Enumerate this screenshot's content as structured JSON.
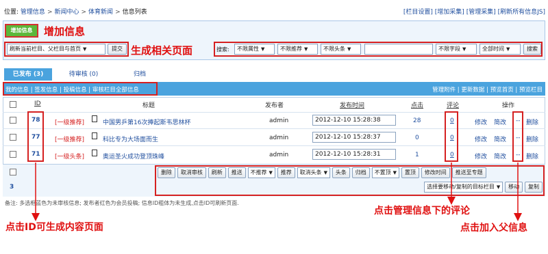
{
  "breadcrumb": {
    "prefix": "位置:",
    "items": [
      "管理信息",
      "新闻中心",
      "体育新闻",
      "信息列表"
    ],
    "sep": ">"
  },
  "top_links": [
    "[栏目设置]",
    "[增加采集]",
    "[管理采集]",
    "[刷新所有信息JS]"
  ],
  "add_button": "增加信息",
  "annotations": {
    "add": "增加信息",
    "generate": "生成相关页面",
    "id_hint": "点击ID可生成内容页面",
    "comment_hint": "点击管理信息下的评论",
    "parent_hint": "点击加入父信息"
  },
  "refresh_select": "刷新当前栏目、父栏目与首页",
  "submit_btn": "提交",
  "search": {
    "label": "搜索:",
    "selects": [
      "不限属性",
      "不限推荐",
      "不限头条"
    ],
    "field_select": "不限字段",
    "time_select": "全部时间",
    "button": "搜索"
  },
  "tabs": [
    "已发布 (3)",
    "待审核 (0)",
    "归档"
  ],
  "subnav_left": [
    "我的信息",
    "签发信息",
    "投稿信息",
    "审核栏目全部信息"
  ],
  "subnav_right": [
    "管理附件",
    "更新数据",
    "预览首页",
    "预览栏目"
  ],
  "columns": {
    "id": "ID",
    "title": "标题",
    "publisher": "发布者",
    "time": "发布时间",
    "clicks": "点击",
    "comments": "评论",
    "actions": "操作"
  },
  "rows": [
    {
      "id": "78",
      "tag": "[一级推荐]",
      "title": "中国男乒第16次捧起斯韦思林杯",
      "publisher": "admin",
      "time": "2012-12-10 15:28:38",
      "clicks": "28",
      "comments": "0",
      "modify": "修改",
      "simple": "简改",
      "parent": "--",
      "delete": "删除"
    },
    {
      "id": "77",
      "tag": "[一级推荐]",
      "title": "科比专为大场面而生",
      "publisher": "admin",
      "time": "2012-12-10 15:28:37",
      "clicks": "0",
      "comments": "0",
      "modify": "修改",
      "simple": "简改",
      "parent": "--",
      "delete": "删除"
    },
    {
      "id": "71",
      "tag": "[一级头条]",
      "title": "奥运圣火成功登顶珠峰",
      "publisher": "admin",
      "time": "2012-12-10 15:28:31",
      "clicks": "1",
      "comments": "0",
      "modify": "修改",
      "simple": "简改",
      "parent": "--",
      "delete": "删除"
    }
  ],
  "bottom_row1": [
    "删除",
    "取消审核",
    "刷新",
    "推送"
  ],
  "bottom_select1": "不推荐",
  "bottom_row1b": [
    "推荐"
  ],
  "bottom_select2": "取消头条",
  "bottom_row1c": [
    "头条",
    "归档"
  ],
  "bottom_select3": "不置顶",
  "bottom_row1d": [
    "置顶",
    "修改时间",
    "推送至专题"
  ],
  "bottom_select4": "选择要移动/复制的目标栏目",
  "bottom_row2": [
    "移动",
    "复制"
  ],
  "page_number": "3",
  "footer_note": "备注: 多选框蓝色为未审核信息; 发布者红色为会员投稿; 信息ID粗体为未生成,点击ID可刷新页面.",
  "colors": {
    "accent": "#4aa3de",
    "annotation": "#e01010",
    "add_green": "#5bb83a"
  }
}
